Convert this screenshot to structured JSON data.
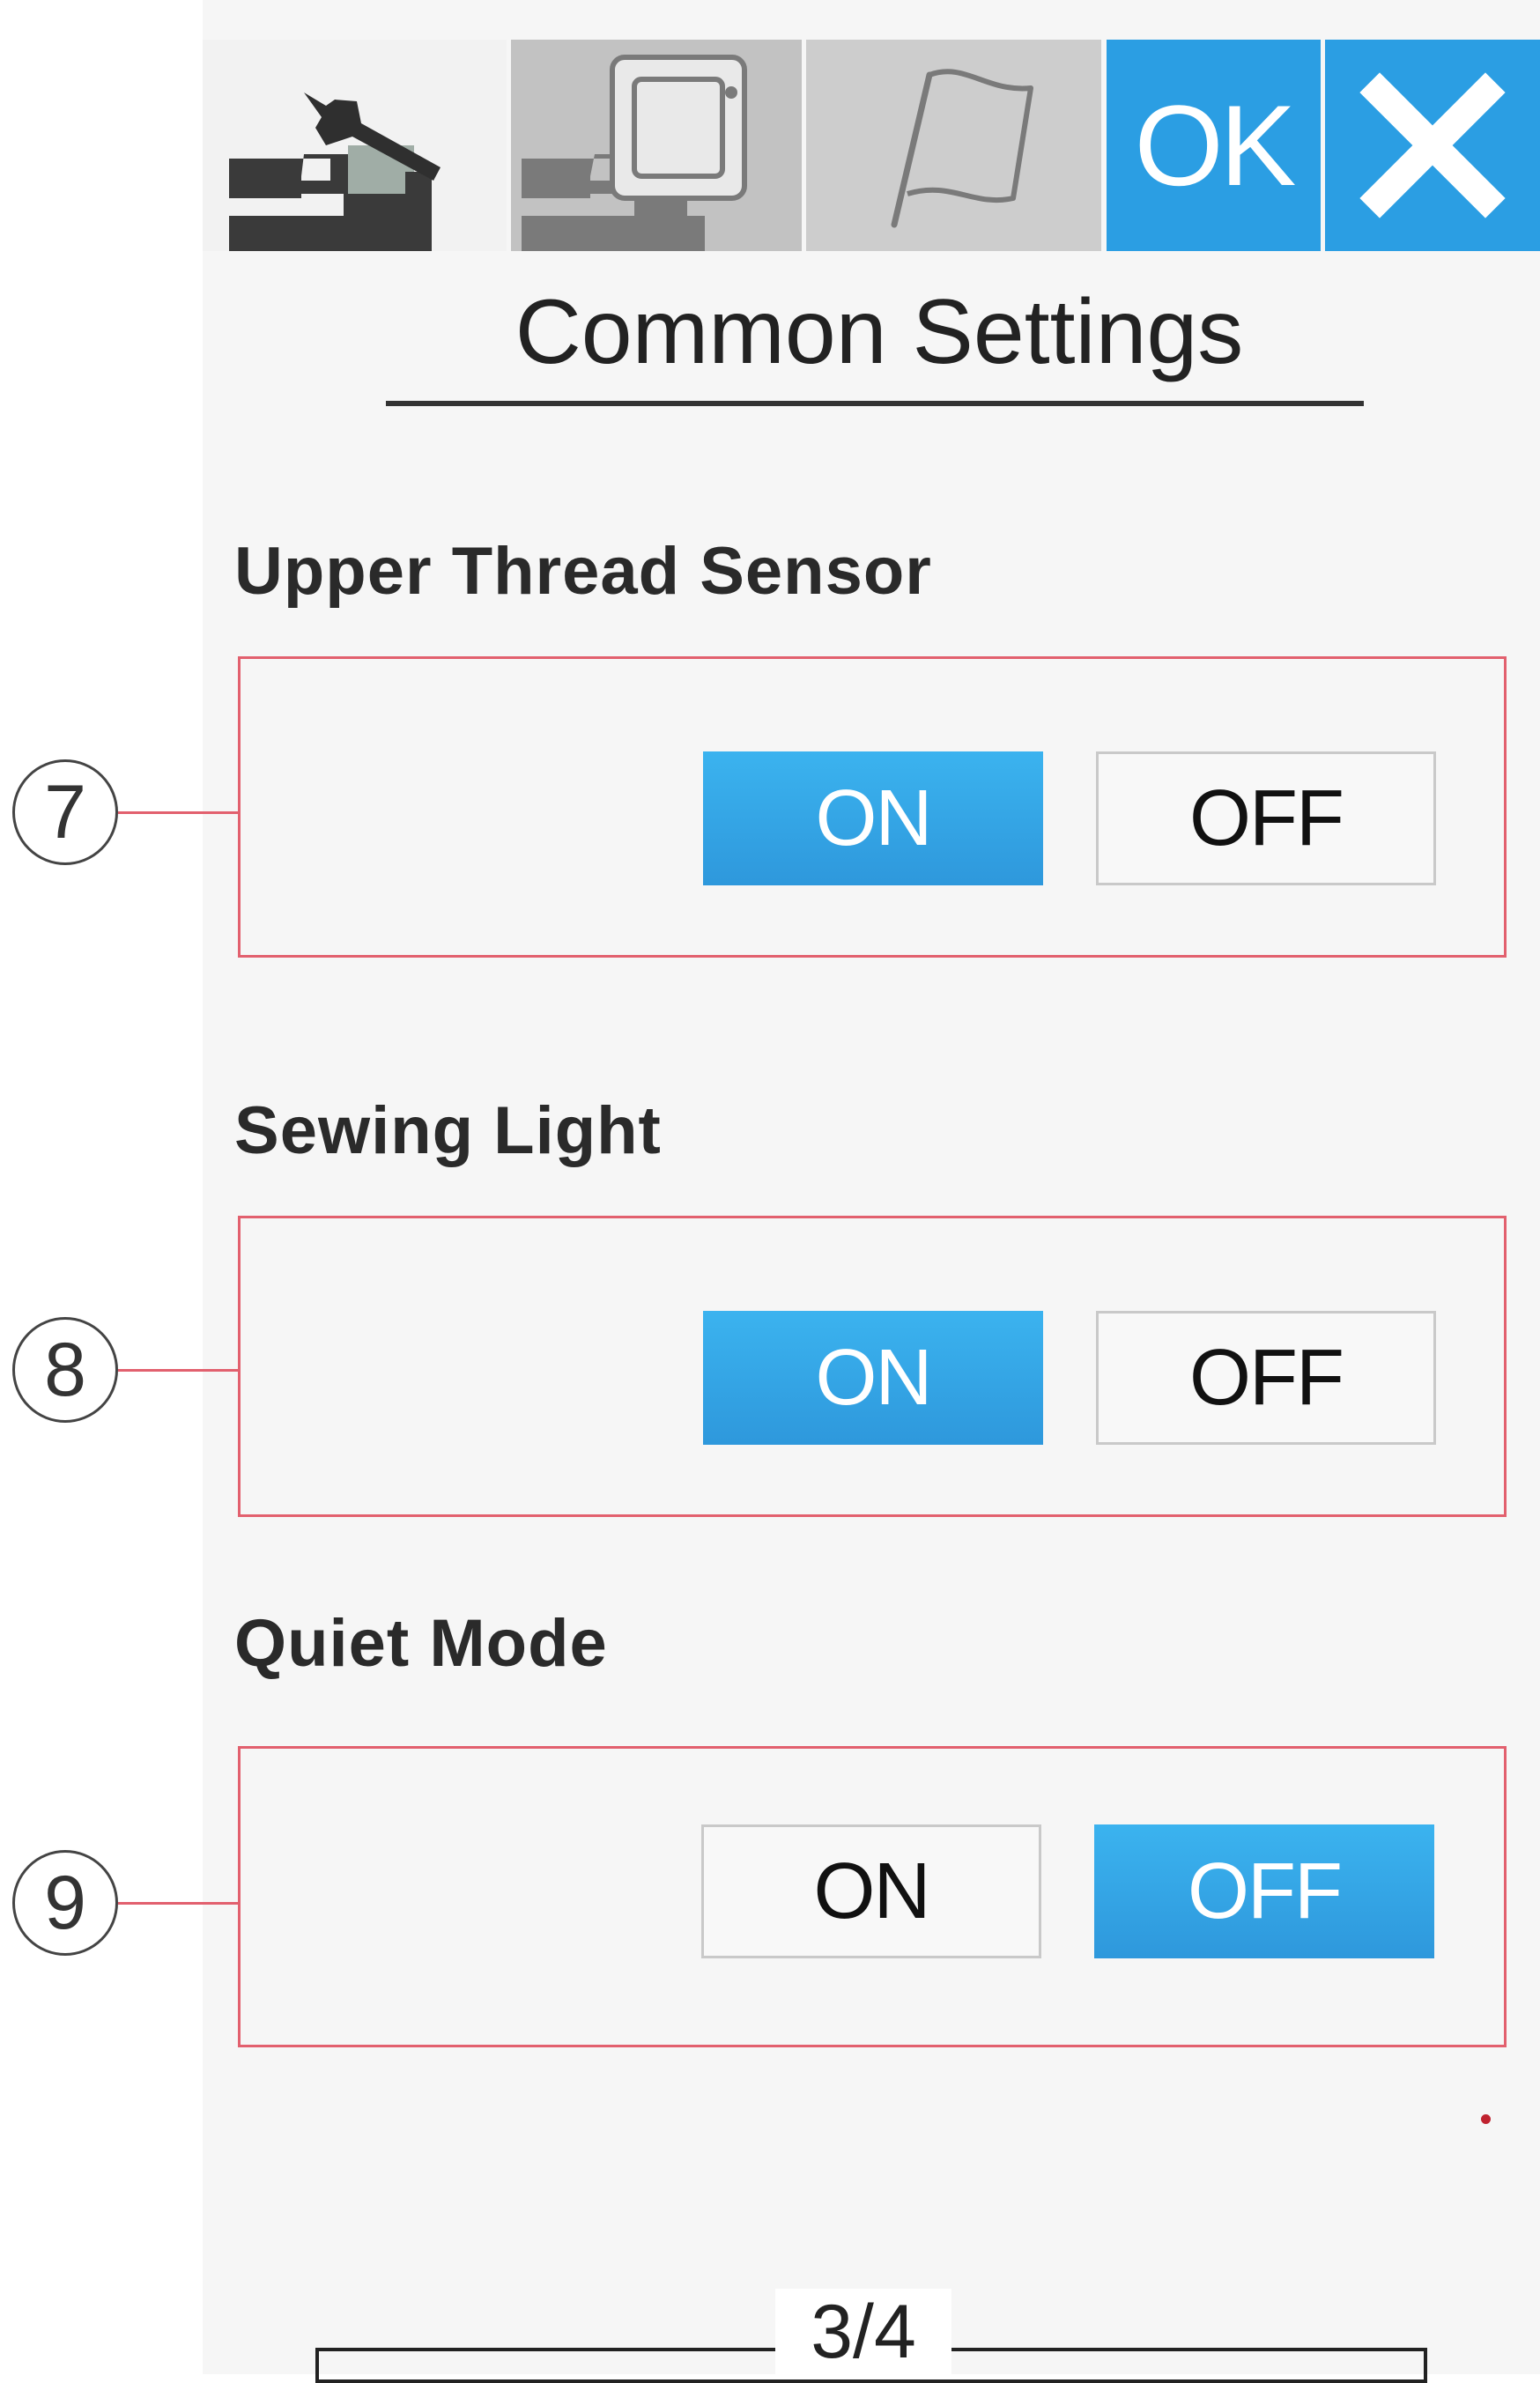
{
  "toolbar": {
    "tabs": [
      {
        "name": "common-settings-tab",
        "icon": "sewing-machine-wrench-icon",
        "active": true
      },
      {
        "name": "embroidery-settings-tab",
        "icon": "sewing-machine-hoop-icon",
        "active": false
      },
      {
        "name": "language-tab",
        "icon": "flag-icon",
        "active": false
      }
    ],
    "ok_label": "OK",
    "close_icon": "close-icon"
  },
  "page_title": "Common Settings",
  "settings": [
    {
      "callout": "7",
      "label": "Upper Thread Sensor",
      "on_label": "ON",
      "off_label": "OFF",
      "selected": "ON"
    },
    {
      "callout": "8",
      "label": "Sewing Light",
      "on_label": "ON",
      "off_label": "OFF",
      "selected": "ON"
    },
    {
      "callout": "9",
      "label": "Quiet Mode",
      "on_label": "ON",
      "off_label": "OFF",
      "selected": "OFF"
    }
  ],
  "page_indicator": "3/4",
  "colors": {
    "accent": "#2b9ee3",
    "callout_border": "#e2606e",
    "inactive_tab": "#c2c2c2"
  }
}
